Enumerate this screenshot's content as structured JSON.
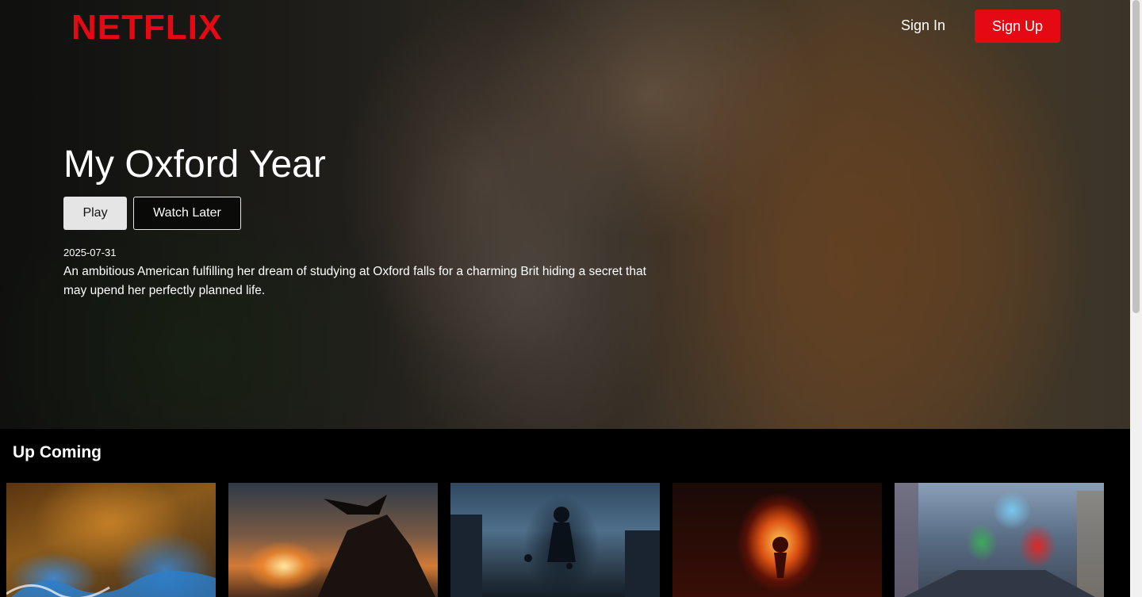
{
  "header": {
    "logo_text": "NETFLIX",
    "sign_in_label": "Sign In",
    "sign_up_label": "Sign Up",
    "accent_color": "#e50914"
  },
  "hero": {
    "title": "My Oxford Year",
    "play_label": "Play",
    "watch_later_label": "Watch Later",
    "release_date": "2025-07-31",
    "description": "An ambitious American fulfilling her dream of studying at Oxford falls for a charming Brit hiding a secret that may upend her perfectly planned life."
  },
  "upcoming": {
    "section_title": "Up Coming",
    "posters": [
      {
        "name": "poster-anime-wave"
      },
      {
        "name": "poster-dragon-cliff"
      },
      {
        "name": "poster-running-kids"
      },
      {
        "name": "poster-fire-figure"
      },
      {
        "name": "poster-smurfs-scooter"
      }
    ]
  }
}
